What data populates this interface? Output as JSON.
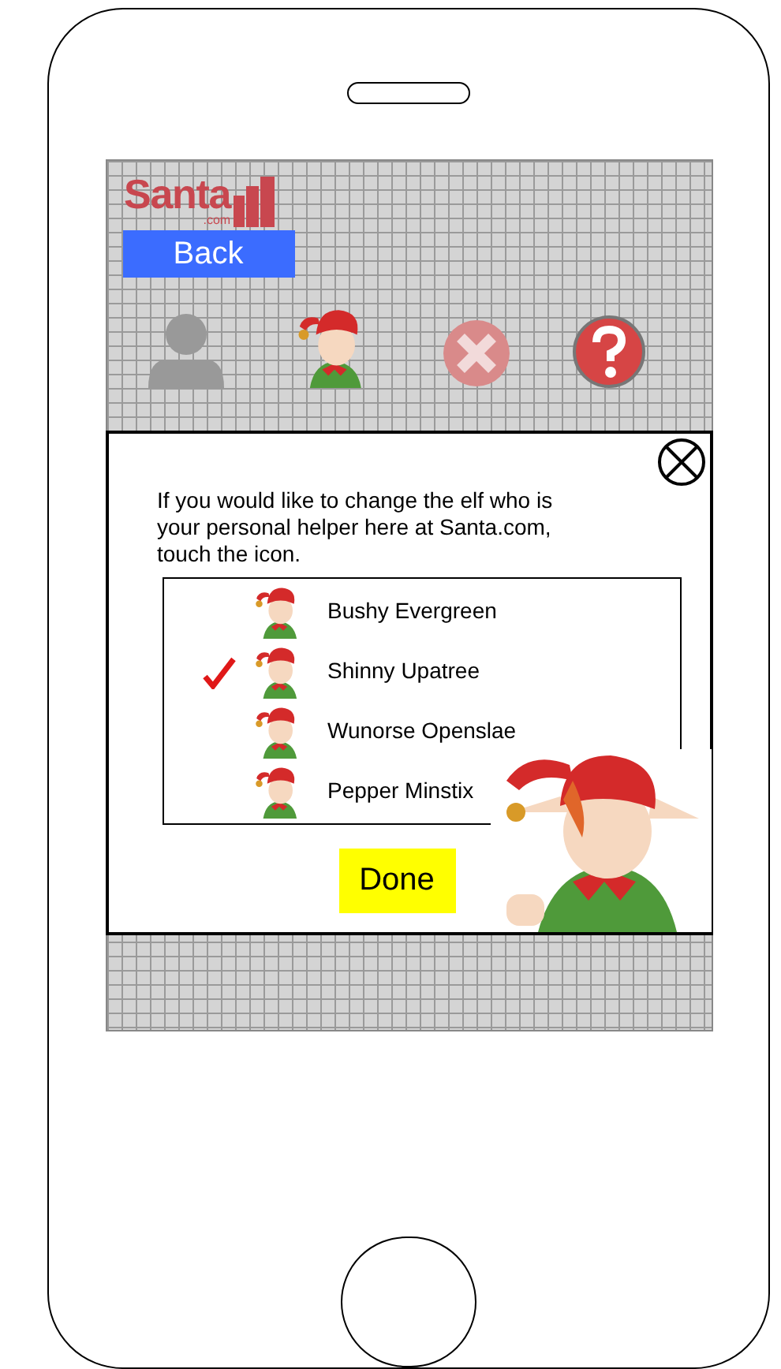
{
  "logo": {
    "name": "Santa",
    "suffix": ".com"
  },
  "back_button": "Back",
  "toolbar": [
    {
      "kind": "person"
    },
    {
      "kind": "elf"
    },
    {
      "kind": "close"
    },
    {
      "kind": "help"
    }
  ],
  "dialog": {
    "message": "If you would like to change the elf who is your personal helper here at Santa.com, touch the icon.",
    "elves": [
      {
        "name": "Bushy Evergreen",
        "selected": false
      },
      {
        "name": "Shinny Upatree",
        "selected": true
      },
      {
        "name": "Wunorse Openslae",
        "selected": false
      },
      {
        "name": "Pepper Minstix",
        "selected": false
      }
    ],
    "done_button": "Done"
  }
}
